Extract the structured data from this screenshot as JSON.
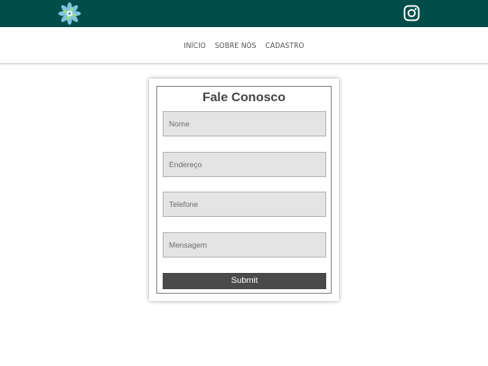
{
  "header": {
    "background": "#004d4a",
    "logo_icon": "mandala-logo-icon",
    "social_icon": "instagram-icon"
  },
  "nav": {
    "items": [
      {
        "label": "INÍCIO"
      },
      {
        "label": "SOBRE NÓS"
      },
      {
        "label": "CADASTRO"
      }
    ]
  },
  "form": {
    "title": "Fale Conosco",
    "fields": [
      {
        "placeholder": "Nome",
        "value": ""
      },
      {
        "placeholder": "Endereço",
        "value": ""
      },
      {
        "placeholder": "Telefone",
        "value": ""
      },
      {
        "placeholder": "Mensagem",
        "value": ""
      }
    ],
    "submit_label": "Submit",
    "colors": {
      "field_bg": "#e4e4e4",
      "button_bg": "#4a4a4a"
    }
  }
}
